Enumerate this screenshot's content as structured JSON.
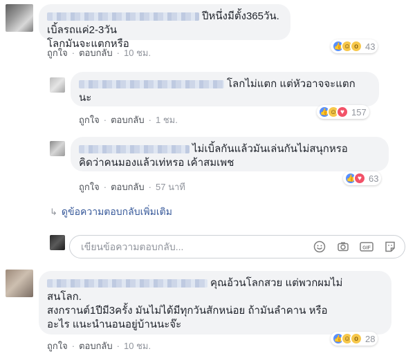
{
  "comments": [
    {
      "text_line1": "ปีหนึ่งมีตั้ง365วัน. เบิ้ลรถแค่2-3วัน",
      "text_line2": "โลกมันจะแตกหรือ",
      "like_label": "ถูกใจ",
      "reply_label": "ตอบกลับ",
      "time": "10 ชม.",
      "reaction_count": "43",
      "reaction_icons": [
        "like-icon",
        "haha-icon",
        "wow-icon"
      ]
    },
    {
      "text_line1": "โลกไม่แตก แต่หัวอาจจะแตก",
      "text_line2": "นะ",
      "like_label": "ถูกใจ",
      "reply_label": "ตอบกลับ",
      "time": "1 ชม.",
      "reaction_count": "157",
      "reaction_icons": [
        "like-icon",
        "haha-icon",
        "love-icon"
      ]
    },
    {
      "text_line1": "ไม่เบิ้ลกันแล้วมันเล่นกันไม่สนุกหรอ",
      "text_line2": "คิดว่าคนมองแล้วเท่หรอ เค้าสมเพช",
      "like_label": "ถูกใจ",
      "reply_label": "ตอบกลับ",
      "time": "57 นาที",
      "reaction_count": "63",
      "reaction_icons": [
        "like-icon",
        "love-icon"
      ]
    },
    {
      "text_line1": "คุณอ้วนโลกสวย แต่พวกผมไม่",
      "text_line2": "สนโลก.",
      "text_line3": "สงกรานต์1ปีมี3ครั้ง มันไม่ได้มีทุกวันสักหน่อย ถ้ามันลำคาน หรือ",
      "text_line4": "อะไร แนะนำนอนอยู่บ้านนะจ๊ะ",
      "like_label": "ถูกใจ",
      "reply_label": "ตอบกลับ",
      "time": "10 ชม.",
      "reaction_count": "28",
      "reaction_icons": [
        "like-icon",
        "haha-icon",
        "wow-icon"
      ]
    }
  ],
  "more_replies_label": "ดูข้อความตอบกลับเพิ่มเติม",
  "reply_box": {
    "placeholder": "เขียนข้อความตอบกลับ...",
    "tools": [
      "emoji-icon",
      "camera-icon",
      "gif-icon",
      "sticker-icon"
    ]
  },
  "colors": {
    "bubble": "#f2f3f5",
    "link": "#365899",
    "like": "#5890ff",
    "love": "#f25268",
    "haha": "#f7c84b"
  }
}
